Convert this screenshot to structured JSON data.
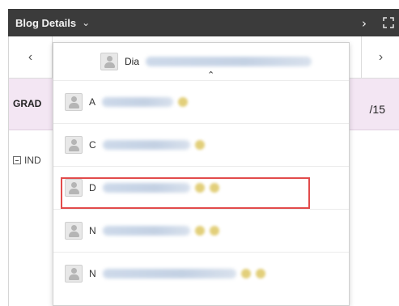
{
  "header": {
    "title": "Blog Details",
    "title_chevron": "⌄",
    "next_arrow": "›",
    "expand_icon": "expand-icon"
  },
  "nav": {
    "prev": "‹",
    "next": "›"
  },
  "grade": {
    "label": "GRAD",
    "score": "/15"
  },
  "index_row": {
    "label": "IND"
  },
  "dropdown": {
    "selected_name": "Dia",
    "caret": "⌃",
    "items": [
      {
        "initial": "A"
      },
      {
        "initial": "C"
      },
      {
        "initial": "D"
      },
      {
        "initial": "N"
      },
      {
        "initial": "N"
      }
    ]
  },
  "colors": {
    "header_bg": "#3b3b3b",
    "grade_bg": "#f3e6f3",
    "highlight": "#e24b4b"
  }
}
